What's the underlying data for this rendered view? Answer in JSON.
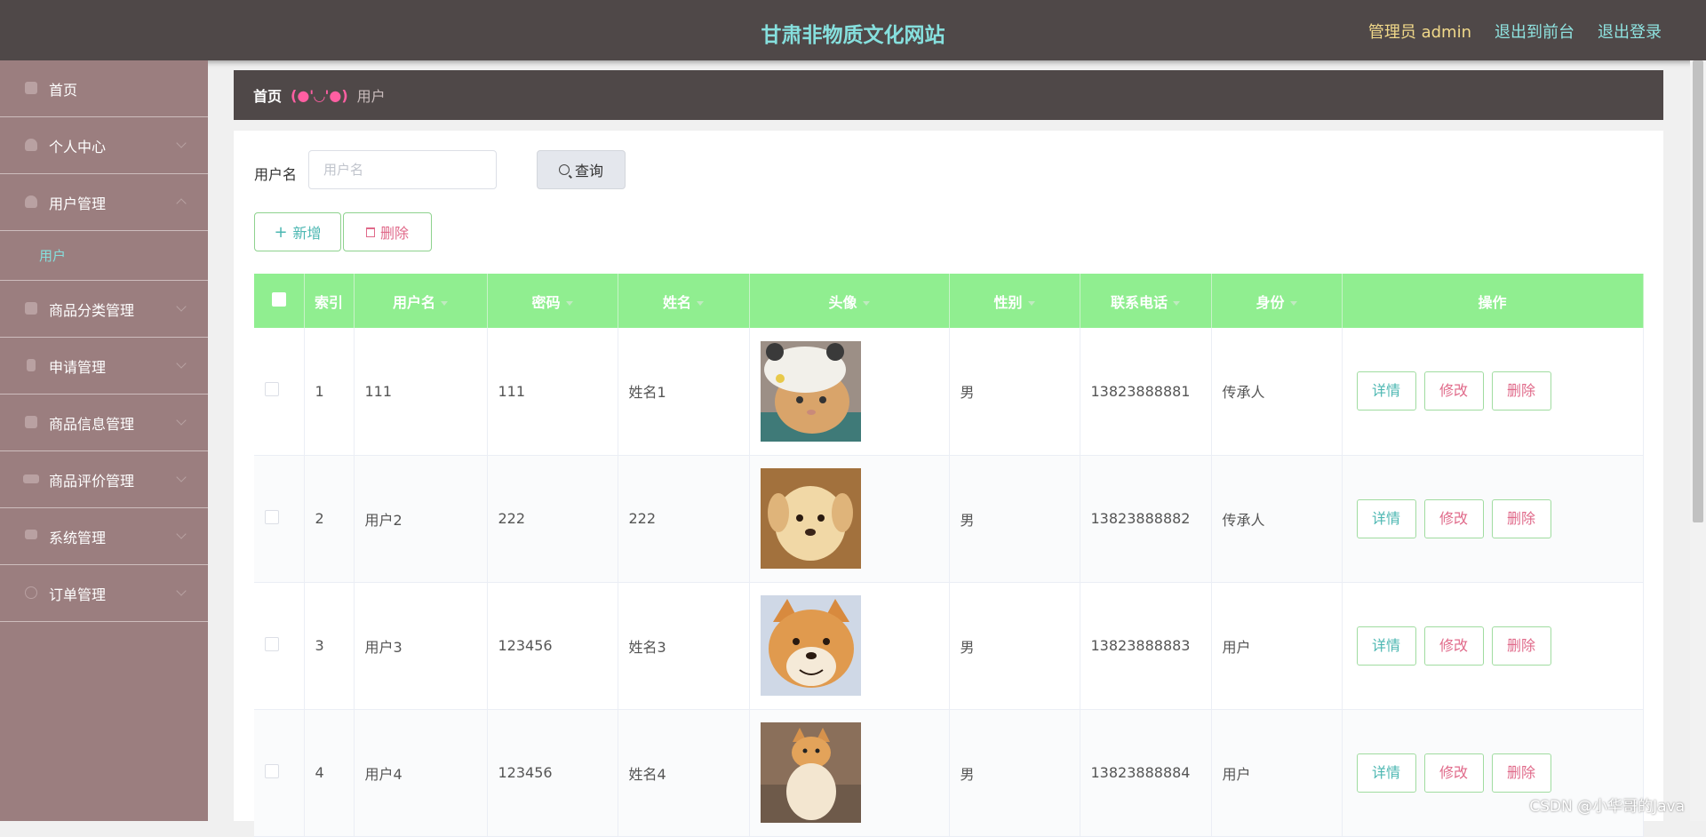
{
  "header": {
    "title": "甘肃非物质文化网站",
    "admin": "管理员 admin",
    "to_front": "退出到前台",
    "logout": "退出登录"
  },
  "sidebar": {
    "items": [
      {
        "label": "首页",
        "icon": "home-icon"
      },
      {
        "label": "个人中心",
        "icon": "user-icon"
      },
      {
        "label": "用户管理",
        "icon": "user-icon",
        "expanded": true,
        "children": [
          "用户"
        ]
      },
      {
        "label": "商品分类管理",
        "icon": "clipboard-icon"
      },
      {
        "label": "申请管理",
        "icon": "phone-icon"
      },
      {
        "label": "商品信息管理",
        "icon": "document-icon"
      },
      {
        "label": "商品评价管理",
        "icon": "ticket-icon"
      },
      {
        "label": "系统管理",
        "icon": "monitor-icon"
      },
      {
        "label": "订单管理",
        "icon": "clock-icon"
      }
    ]
  },
  "breadcrumb": {
    "home": "首页",
    "separator": "(●'◡'●)",
    "current": "用户"
  },
  "search": {
    "label": "用户名",
    "placeholder": "用户名",
    "button": "查询"
  },
  "actions": {
    "add": "新增",
    "delete": "删除"
  },
  "table": {
    "columns": [
      "索引",
      "用户名",
      "密码",
      "姓名",
      "头像",
      "性别",
      "联系电话",
      "身份",
      "操作"
    ],
    "row_actions": {
      "detail": "详情",
      "edit": "修改",
      "delete": "删除"
    },
    "rows": [
      {
        "index": "1",
        "username": "111",
        "password": "111",
        "name": "姓名1",
        "avatar": "cat",
        "gender": "男",
        "phone": "13823888881",
        "identity": "传承人"
      },
      {
        "index": "2",
        "username": "用户2",
        "password": "222",
        "name": "222",
        "avatar": "puppy",
        "gender": "男",
        "phone": "13823888882",
        "identity": "传承人"
      },
      {
        "index": "3",
        "username": "用户3",
        "password": "123456",
        "name": "姓名3",
        "avatar": "shiba",
        "gender": "男",
        "phone": "13823888883",
        "identity": "用户"
      },
      {
        "index": "4",
        "username": "用户4",
        "password": "123456",
        "name": "姓名4",
        "avatar": "shiba-sitting",
        "gender": "男",
        "phone": "13823888884",
        "identity": "用户"
      }
    ]
  },
  "watermark": "CSDN @小华哥的Java",
  "colors": {
    "header_bg": "#4f4848",
    "sidebar_bg": "#9b7e7f",
    "accent": "#86e0de",
    "table_header": "#90ee90",
    "danger": "#e06a8a"
  }
}
